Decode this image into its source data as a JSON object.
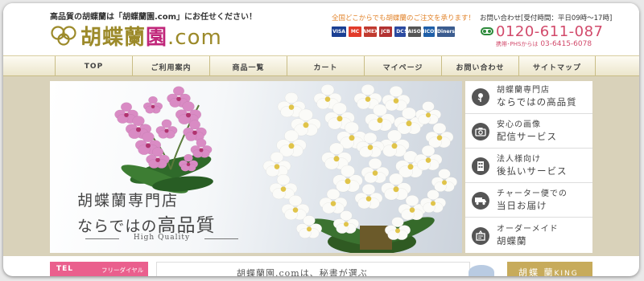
{
  "header": {
    "tagline": "高品質の胡蝶蘭は「胡蝶蘭園.com」にお任せください！",
    "logo": {
      "main": "胡蝶蘭",
      "accent": "園",
      "suffix": ".com"
    },
    "shipping_note": "全国どこからでも胡蝶蘭のご注文を承ります！",
    "payment_cards": [
      {
        "name": "VISA",
        "color": "#1a3f93"
      },
      {
        "name": "MC",
        "color": "#e23b2a"
      },
      {
        "name": "AMEX",
        "color": "#c13a2f"
      },
      {
        "name": "JCB",
        "color": "#b23232"
      },
      {
        "name": "DC",
        "color": "#2b4aa0"
      },
      {
        "name": "SAISON",
        "color": "#555555"
      },
      {
        "name": "NICOS",
        "color": "#1f5fa8"
      },
      {
        "name": "Diners",
        "color": "#3b5c8f"
      }
    ],
    "contact_label": "お問い合わせ[受付時間：平日09時～17時]",
    "phone": "0120-611-087",
    "mobile_label": "携帯･PHSからは",
    "mobile_number": "03-6415-6078"
  },
  "nav": {
    "items": [
      "TOP",
      "ご利用案内",
      "商品一覧",
      "カート",
      "マイページ",
      "お問い合わせ",
      "サイトマップ"
    ]
  },
  "hero": {
    "title_line1": "胡蝶蘭専門店",
    "title_line2_pre": "ならではの",
    "title_line2_big": "高品質",
    "subtitle": "High Quality"
  },
  "side_menu": [
    {
      "line1": "胡蝶蘭専門店",
      "line2": "ならではの高品質",
      "icon": "orchid-icon"
    },
    {
      "line1": "安心の画像",
      "line2": "配信サービス",
      "icon": "camera-icon"
    },
    {
      "line1": "法人様向け",
      "line2": "後払いサービス",
      "icon": "building-icon"
    },
    {
      "line1": "チャーター便での",
      "line2": "当日お届け",
      "icon": "truck-icon"
    },
    {
      "line1": "オーダーメイド",
      "line2": "胡蝶蘭",
      "icon": "pen-icon"
    }
  ],
  "bottom": {
    "tel_label": "TEL",
    "free_dial": "フリーダイヤル",
    "intro_text": "胡蝶蘭園.comは、秘書が選ぶ",
    "king_text": "胡蝶",
    "king_accent": "蘭",
    "king_suffix": "KING"
  },
  "colors": {
    "gold": "#9c8a2a",
    "pink": "#d24a6b",
    "orange": "#e2832a",
    "nav_border": "#c9bd86"
  }
}
